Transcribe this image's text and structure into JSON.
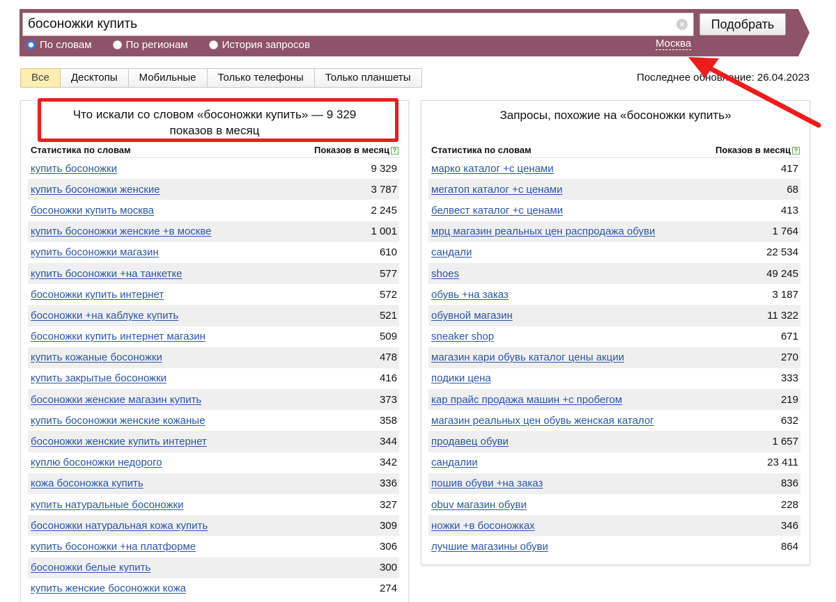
{
  "search": {
    "query": "босоножки купить",
    "submit_label": "Подобрать",
    "modes": [
      {
        "label": "По словам",
        "checked": true
      },
      {
        "label": "По регионам",
        "checked": false
      },
      {
        "label": "История запросов",
        "checked": false
      }
    ],
    "region": "Москва"
  },
  "device_tabs": [
    "Все",
    "Десктопы",
    "Мобильные",
    "Только телефоны",
    "Только планшеты"
  ],
  "active_tab": "Все",
  "updated_text": "Последнее обновление: 26.04.2023",
  "colors": {
    "band": "#8e5368",
    "link": "#2a55a8",
    "highlight": "#ee1c1c",
    "active_tab": "#fdedb0"
  },
  "left_panel": {
    "title": "Что искали со словом «босоножки купить» — 9 329 показов в месяц",
    "col_keyword": "Статистика по словам",
    "col_count": "Показов в месяц",
    "rows": [
      {
        "keyword": "купить босоножки",
        "count": "9 329"
      },
      {
        "keyword": "купить босоножки женские",
        "count": "3 787"
      },
      {
        "keyword": "босоножки купить москва",
        "count": "2 245"
      },
      {
        "keyword": "купить босоножки женские +в москве",
        "count": "1 001"
      },
      {
        "keyword": "купить босоножки магазин",
        "count": "610"
      },
      {
        "keyword": "купить босоножки +на танкетке",
        "count": "577"
      },
      {
        "keyword": "босоножки купить интернет",
        "count": "572"
      },
      {
        "keyword": "босоножки +на каблуке купить",
        "count": "521"
      },
      {
        "keyword": "босоножки купить интернет магазин",
        "count": "509"
      },
      {
        "keyword": "купить кожаные босоножки",
        "count": "478"
      },
      {
        "keyword": "купить закрытые босоножки",
        "count": "416"
      },
      {
        "keyword": "босоножки женские магазин купить",
        "count": "373"
      },
      {
        "keyword": "купить босоножки женские кожаные",
        "count": "358"
      },
      {
        "keyword": "босоножки женские купить интернет",
        "count": "344"
      },
      {
        "keyword": "куплю босоножки недорого",
        "count": "342"
      },
      {
        "keyword": "кожа босоножка купить",
        "count": "336"
      },
      {
        "keyword": "купить натуральные босоножки",
        "count": "327"
      },
      {
        "keyword": "босоножки натуральная кожа купить",
        "count": "309"
      },
      {
        "keyword": "купить босоножки +на платформе",
        "count": "306"
      },
      {
        "keyword": "босоножки белые купить",
        "count": "300"
      },
      {
        "keyword": "купить женские босоножки кожа",
        "count": "274"
      }
    ]
  },
  "right_panel": {
    "title": "Запросы, похожие на «босоножки купить»",
    "col_keyword": "Статистика по словам",
    "col_count": "Показов в месяц",
    "rows": [
      {
        "keyword": "марко каталог +с ценами",
        "count": "417"
      },
      {
        "keyword": "мегатоп каталог +с ценами",
        "count": "68"
      },
      {
        "keyword": "белвест каталог +с ценами",
        "count": "413"
      },
      {
        "keyword": "мрц магазин реальных цен распродажа обуви",
        "count": "1 764"
      },
      {
        "keyword": "сандали",
        "count": "22 534"
      },
      {
        "keyword": "shoes",
        "count": "49 245"
      },
      {
        "keyword": "обувь +на заказ",
        "count": "3 187"
      },
      {
        "keyword": "обувной магазин",
        "count": "11 322"
      },
      {
        "keyword": "sneaker shop",
        "count": "671"
      },
      {
        "keyword": "магазин кари обувь каталог цены акции",
        "count": "270"
      },
      {
        "keyword": "подики цена",
        "count": "333"
      },
      {
        "keyword": "кар прайс продажа машин +с пробегом",
        "count": "219"
      },
      {
        "keyword": "магазин реальных цен обувь женская каталог",
        "count": "632"
      },
      {
        "keyword": "продавец обуви",
        "count": "1 657"
      },
      {
        "keyword": "сандалии",
        "count": "23 411"
      },
      {
        "keyword": "пошив обуви +на заказ",
        "count": "836"
      },
      {
        "keyword": "obuv магазин обуви",
        "count": "228"
      },
      {
        "keyword": "ножки +в босоножках",
        "count": "346"
      },
      {
        "keyword": "лучшие магазины обуви",
        "count": "864"
      }
    ]
  }
}
